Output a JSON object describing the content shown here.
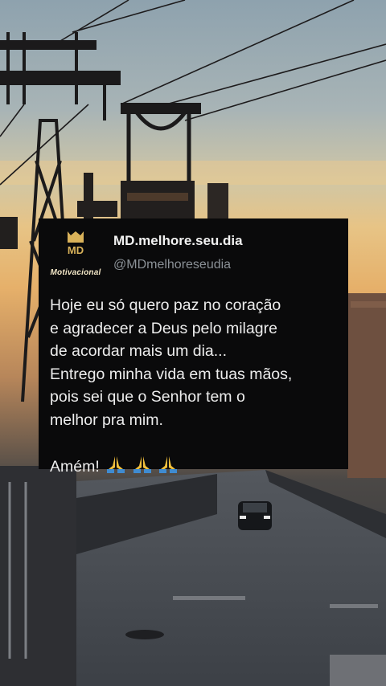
{
  "post": {
    "avatar_text": "Motivacional",
    "display_name": "MD.melhore.seu.dia",
    "handle": "@MDmelhoreseudia",
    "lines": [
      "Hoje eu só quero paz no coração",
      "e agradecer a Deus pelo milagre",
      "de acordar mais um dia...",
      "Entrego minha vida em tuas mãos,",
      "pois sei que o Senhor tem o",
      "melhor pra mim."
    ],
    "closing": "Amém!",
    "closing_icons": [
      "praying-hands-icon",
      "praying-hands-icon",
      "praying-hands-icon"
    ]
  },
  "colors": {
    "card_background": "#0a0a0b",
    "text": "#ededed",
    "handle": "#8b9197",
    "monogram": "#d9b25a"
  }
}
